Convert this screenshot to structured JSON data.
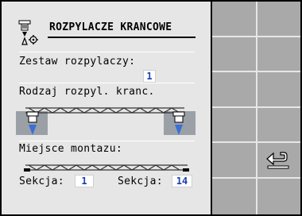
{
  "title": "ROZPYLACZE KRANCOWE",
  "fields": {
    "zestaw_label": "Zestaw rozpylaczy:",
    "zestaw_value": "1",
    "rodzaj_label": "Rodzaj rozpyl. kranc.",
    "miejsce_label": "Miejsce montazu:",
    "sekcja_left_label": "Sekcja:",
    "sekcja_left_value": "1",
    "sekcja_right_label": "Sekcja:",
    "sekcja_right_value": "14"
  },
  "softkeys": [
    {
      "row": 1,
      "icon": ""
    },
    {
      "row": 2,
      "icon": ""
    },
    {
      "row": 3,
      "icon": ""
    },
    {
      "row": 4,
      "icon": ""
    },
    {
      "row": 5,
      "icon": "return-arrow-icon"
    },
    {
      "row": 6,
      "icon": ""
    }
  ],
  "colors": {
    "panel_bg": "#e6e6e6",
    "softkey_bg": "#a9a9a9",
    "value_text": "#1a3fb0"
  }
}
